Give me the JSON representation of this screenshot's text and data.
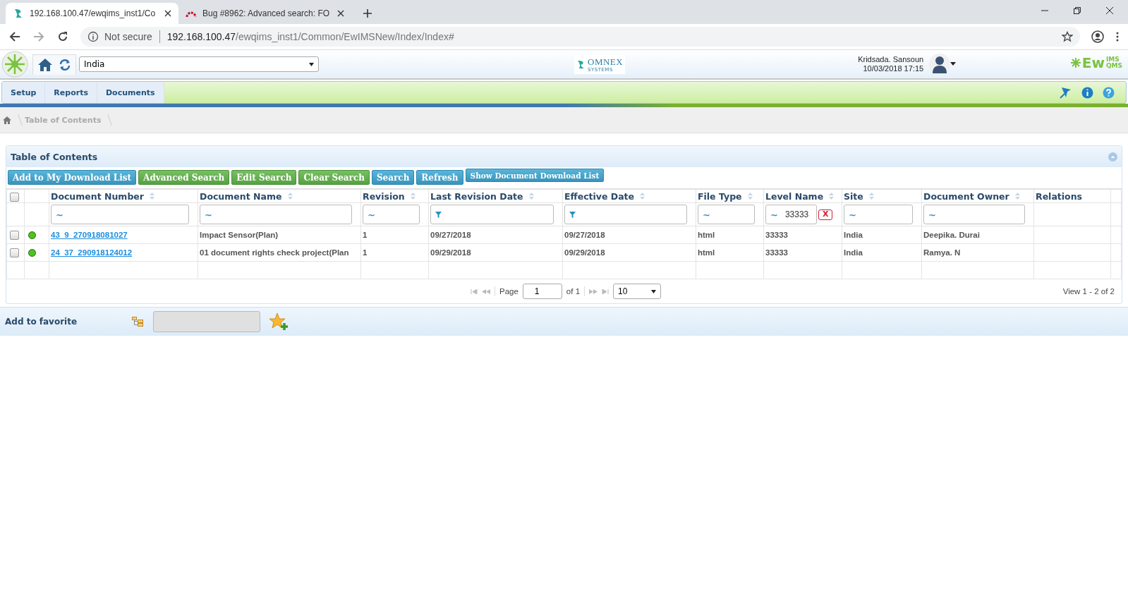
{
  "browser": {
    "tabs": [
      {
        "title": "192.168.100.47/ewqims_inst1/Co",
        "selected": true,
        "kind": "app"
      },
      {
        "title": "Bug #8962: Advanced search: FO",
        "selected": false,
        "kind": "bug"
      }
    ],
    "security": "Not secure",
    "url_host": "192.168.100.47",
    "url_path": "/ewqims_inst1/Common/EwIMSNew/Index/Index#"
  },
  "header": {
    "site_select": "India",
    "company_logo": {
      "name": "OMNEX",
      "tagline": "SYSTEMS"
    },
    "user": "Kridsada. Sansoun",
    "datetime": "10/03/2018 17:15",
    "brand": {
      "main": "Ew",
      "sup": "IMS",
      "sub": "QMS"
    }
  },
  "menu": [
    {
      "label": "Setup"
    },
    {
      "label": "Reports"
    },
    {
      "label": "Documents"
    }
  ],
  "breadcrumb": [
    "Table of Contents"
  ],
  "panel": {
    "title": "Table of Contents",
    "buttons": [
      {
        "label": "Add to My Download List",
        "kind": "primary"
      },
      {
        "label": "Advanced Search",
        "kind": "success"
      },
      {
        "label": "Edit Search",
        "kind": "success"
      },
      {
        "label": "Clear Search",
        "kind": "success"
      },
      {
        "label": "Search",
        "kind": "primary"
      },
      {
        "label": "Refresh",
        "kind": "primary"
      },
      {
        "label": "Show Document Download List",
        "kind": "small"
      }
    ],
    "table": {
      "select_all": false,
      "columns": [
        {
          "label": "Document Number",
          "sortable": true,
          "filter": {
            "kind": "text",
            "symbol": "~"
          }
        },
        {
          "label": "Document Name",
          "sortable": true,
          "filter": {
            "kind": "text",
            "symbol": "~"
          }
        },
        {
          "label": "Revision",
          "sortable": true,
          "filter": {
            "kind": "text",
            "symbol": "~"
          }
        },
        {
          "label": "Last Revision Date",
          "sortable": true,
          "filter": {
            "kind": "date"
          }
        },
        {
          "label": "Effective Date",
          "sortable": true,
          "filter": {
            "kind": "date"
          }
        },
        {
          "label": "File Type",
          "sortable": true,
          "filter": {
            "kind": "text",
            "symbol": "~"
          }
        },
        {
          "label": "Level Name",
          "sortable": true,
          "filter": {
            "kind": "text",
            "symbol": "~",
            "value": "33333",
            "clear": "X"
          }
        },
        {
          "label": "Site",
          "sortable": true,
          "filter": {
            "kind": "text",
            "symbol": "~"
          }
        },
        {
          "label": "Document Owner",
          "sortable": true,
          "filter": {
            "kind": "text",
            "symbol": "~"
          }
        },
        {
          "label": "Relations",
          "sortable": false
        }
      ],
      "rows": [
        {
          "checked": false,
          "color": "#4cc41c",
          "cells": [
            "43_9_270918081027",
            "Impact Sensor(Plan)",
            "1",
            "09/27/2018",
            "09/27/2018",
            "html",
            "33333",
            "India",
            "Deepika.  Durai",
            ""
          ]
        },
        {
          "checked": false,
          "color": "#4cc41c",
          "cells": [
            "24_37_290918124012",
            "01 document rights check project(Plan",
            "1",
            "09/29/2018",
            "09/29/2018",
            "html",
            "33333",
            "India",
            "Ramya.  N",
            ""
          ]
        }
      ]
    },
    "pager": {
      "page_label": "Page",
      "page": "1",
      "of": "of 1",
      "page_size": "10",
      "summary": "View 1 - 2 of 2"
    }
  },
  "favorite": {
    "label": "Add to favorite",
    "disabled": true
  }
}
